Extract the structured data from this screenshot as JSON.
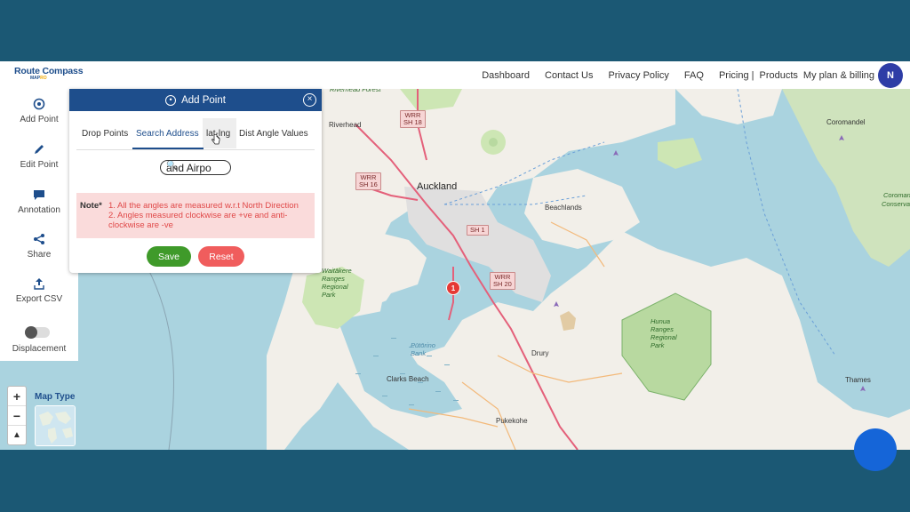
{
  "brand": {
    "line1": "Route Compass",
    "line2a": "MAP",
    "line2b": "RO"
  },
  "nav": {
    "dashboard": "Dashboard",
    "contact": "Contact Us",
    "privacy": "Privacy Policy",
    "faq": "FAQ",
    "pricing": "Pricing |",
    "products": "Products",
    "plan": "My plan & billing",
    "avatar": "N"
  },
  "sidebar": {
    "add_point": "Add Point",
    "edit_point": "Edit Point",
    "annotation": "Annotation",
    "share": "Share",
    "export_csv": "Export CSV",
    "displacement": "Displacement"
  },
  "panel": {
    "title": "Add Point",
    "tabs": [
      "Drop Points",
      "Search Address",
      "lat-lng",
      "Dist Angle Values"
    ],
    "active_tab": "Search Address",
    "search_value": "and Airpo",
    "note_label": "Note*",
    "note_line1": "1. All the angles are measured w.r.t North Direction",
    "note_line2": "2. Angles measured clockwise are +ve and anti-clockwise are -ve",
    "save": "Save",
    "reset": "Reset"
  },
  "map": {
    "map_type_label": "Map Type",
    "zoom_in": "+",
    "zoom_out": "−",
    "reset_north": "▲",
    "marker_number": "1",
    "labels": {
      "auckland": "Auckland",
      "riverhead": "Riverhead",
      "beachlands": "Beachlands",
      "clarks_beach": "Clarks Beach",
      "drury": "Drury",
      "pukekohe": "Pukekohe",
      "thames": "Thames",
      "coromandel": "Coromandel",
      "waitakere": "Waitākere Ranges Regional Park",
      "hunua": "Hunua Ranges Regional Park",
      "pahurehure": "Pūtōrino Bank",
      "riverhead_forest": "Riverhead Forest",
      "conservation_a": "Coromandel",
      "conservation_b": "Conservation"
    },
    "shields": {
      "wrr_sh18": [
        "WRR",
        "SH 18"
      ],
      "wrr_sh16": [
        "WRR",
        "SH 16"
      ],
      "sh1": [
        "SH 1"
      ],
      "wrr_sh20": [
        "WRR",
        "SH 20"
      ]
    }
  },
  "colors": {
    "primary": "#1e4e8c",
    "save": "#3f9a2a",
    "reset": "#f05d5d",
    "marker": "#e53935",
    "frame": "#1b5874"
  }
}
